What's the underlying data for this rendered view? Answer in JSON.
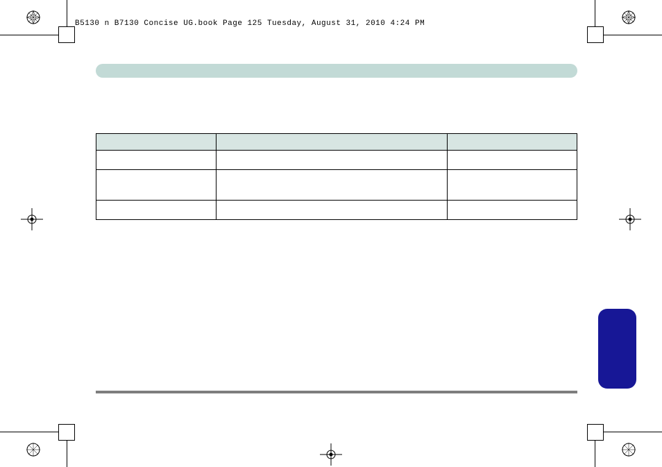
{
  "header": {
    "text": "B5130 n B7130 Concise UG.book  Page 125  Tuesday, August 31, 2010  4:24 PM"
  },
  "banner": {
    "label": ""
  },
  "table": {
    "headers": [
      "",
      "",
      ""
    ],
    "rows": [
      [
        "",
        "",
        ""
      ],
      [
        "",
        "",
        ""
      ],
      [
        "",
        "",
        ""
      ]
    ]
  }
}
